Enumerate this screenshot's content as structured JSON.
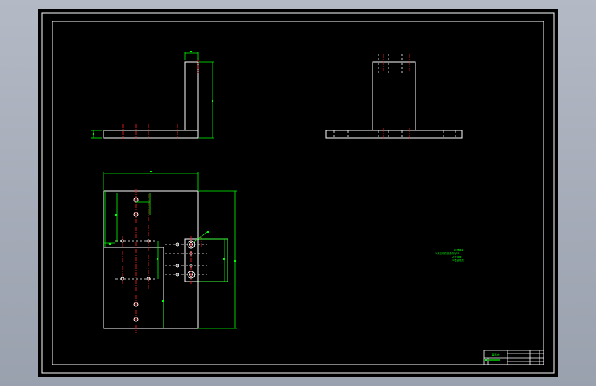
{
  "app": {
    "view_background": "#000000",
    "window_background": "#a9b0bc"
  },
  "drawing": {
    "colors": {
      "outline": "#ffffff",
      "dimension": "#00ff00",
      "centerline": "#ff2020"
    },
    "technical_notes": {
      "heading": "技术要求",
      "line1": "1.未注明的倒角均为C1",
      "line2": "2.去毛刺",
      "line3": "3.表面发黑"
    },
    "title_block": {
      "name": "某零件",
      "cells": [
        "",
        "",
        "",
        ""
      ]
    }
  }
}
